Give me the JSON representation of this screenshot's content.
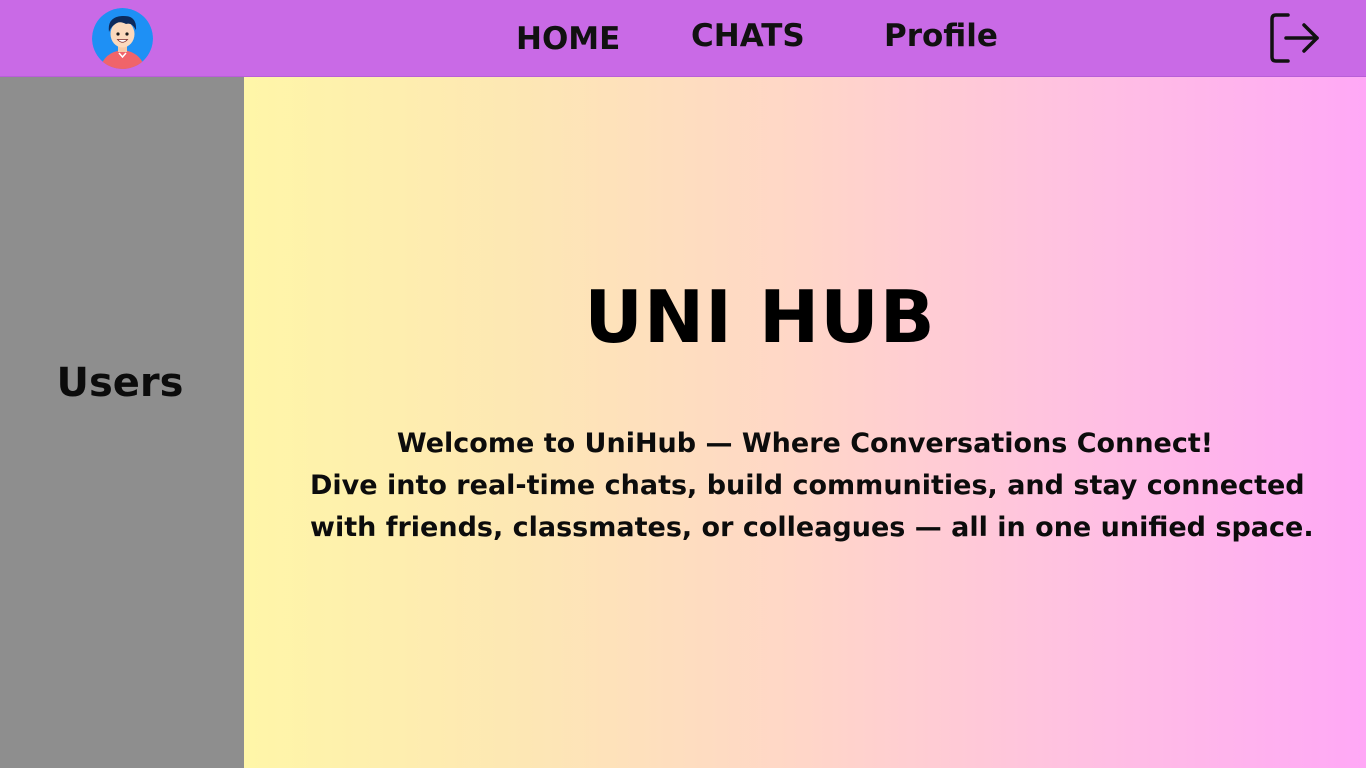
{
  "nav": {
    "home_label": "HOME",
    "chats_label": "CHATS",
    "profile_label": "Profile",
    "avatar_icon": "user-avatar-icon",
    "logout_icon": "logout-icon"
  },
  "sidebar": {
    "title": "Users"
  },
  "main": {
    "title": "UNI HUB",
    "welcome_lines": [
      "Welcome to UniHub — Where Conversations Connect!",
      "Dive into real-time chats, build communities, and stay connected",
      "with friends, classmates, or colleagues — all in one unified space."
    ]
  },
  "colors": {
    "topbar": "#c96ae6",
    "sidebar": "#8e8e8e",
    "gradient_start": "#fff6a8",
    "gradient_end": "#ffa8f6"
  }
}
